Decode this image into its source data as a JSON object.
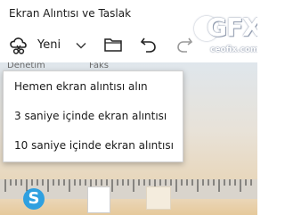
{
  "window": {
    "title": "Ekran Alıntısı ve Taslak"
  },
  "watermark": {
    "logo": "GFX",
    "domain": "ceofix.com"
  },
  "toolbar": {
    "new_label": "Yeni"
  },
  "menu": {
    "items": [
      {
        "label": "Hemen ekran alıntısı alın"
      },
      {
        "label": "3 saniye içinde ekran alıntısı"
      },
      {
        "label": "10 saniye içinde ekran alıntısı"
      }
    ]
  },
  "canvas": {
    "left_fragment": "Denetim",
    "right_fragment": "Faks"
  },
  "icons": {
    "new": "snip-icon",
    "chevron": "chevron-down-icon",
    "open": "folder-icon",
    "undo": "undo-icon",
    "redo": "redo-icon",
    "skype": "skype-icon"
  },
  "colors": {
    "accent": "#2fa0e0",
    "menu_bg": "#ffffff",
    "canvas_bottom": "#e7cfa8"
  }
}
